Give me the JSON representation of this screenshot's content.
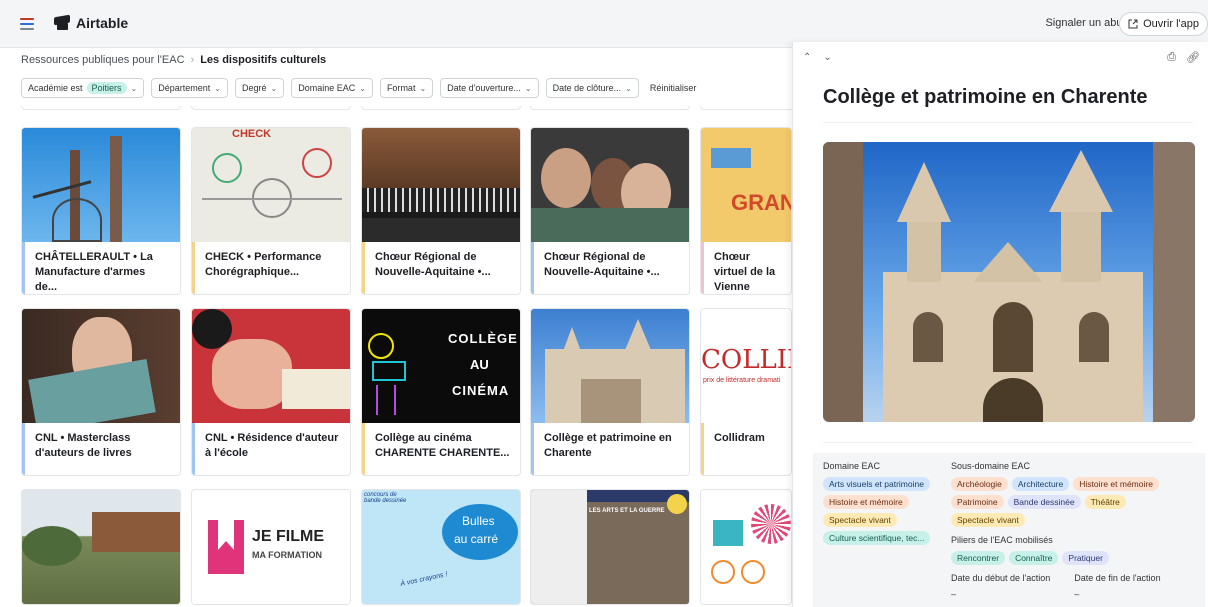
{
  "app": {
    "brand": "Airtable",
    "report_label": "Signaler un abus",
    "open_app_label": "Ouvrir l'app"
  },
  "breadcrumb": {
    "parent": "Ressources publiques pour l'EAC",
    "current": "Les dispositifs culturels"
  },
  "filters": [
    {
      "label": "Académie est",
      "chip": "Poitiers"
    },
    {
      "label": "Département"
    },
    {
      "label": "Degré"
    },
    {
      "label": "Domaine EAC"
    },
    {
      "label": "Format"
    },
    {
      "label": "Date d'ouverture..."
    },
    {
      "label": "Date de clôture..."
    }
  ],
  "reset_label": "Réinitialiser",
  "cards": [
    {
      "title": "CHÂTELLERAULT • La Manufacture d'armes de...",
      "accent": "#9fc6f0"
    },
    {
      "title": "CHECK • Performance Chorégraphique...",
      "accent": "#f5d48a"
    },
    {
      "title": "Chœur Régional de Nouvelle-Aquitaine •...",
      "accent": "#f5d48a"
    },
    {
      "title": "Chœur Régional de Nouvelle-Aquitaine •...",
      "accent": "#9fc6f0"
    },
    {
      "title": "Chœur virtuel de la Vienne",
      "accent": "#f3c0d4"
    },
    {
      "title": "CNL • Masterclass d'auteurs de livres",
      "accent": "#9fc6f0"
    },
    {
      "title": "CNL • Résidence d'auteur à l'école",
      "accent": "#9fc6f0"
    },
    {
      "title": "Collège au cinéma CHARENTE CHARENTE...",
      "accent": "#f5d48a"
    },
    {
      "title": "Collège et patrimoine en Charente",
      "accent": "#9fc6f0"
    },
    {
      "title": "Collidram",
      "accent": "#f5d48a"
    }
  ],
  "card_images": {
    "cinema_line1": "COLLÈGE",
    "cinema_line2": "AU",
    "cinema_line3": "CINÉMA",
    "collidram_text": "COLLID",
    "collidram_sub": "prix de littérature dramati",
    "jefilme_line1": "JE FILME",
    "jefilme_line2": "MA FORMATION",
    "bulles_line1": "Bulles",
    "bulles_line2": "au carré",
    "bulles_top": "concours de bande dessinée",
    "bulles_bottom": "À vos crayons !",
    "check_text": "CHECK",
    "arts_guerre": "LES ARTS ET LA GUERRE",
    "grand_text": "GRAN"
  },
  "panel": {
    "title": "Collège et patrimoine en Charente",
    "domaine_label": "Domaine EAC",
    "domaine_tags": [
      {
        "text": "Arts visuels et patrimoine",
        "color": "blue"
      },
      {
        "text": "Histoire et mémoire",
        "color": "orange"
      },
      {
        "text": "Spectacle vivant",
        "color": "yellow"
      },
      {
        "text": "Culture scientifique, tec...",
        "color": "teal"
      }
    ],
    "sous_label": "Sous-domaine EAC",
    "sous_tags": [
      {
        "text": "Archéologie",
        "color": "orange"
      },
      {
        "text": "Architecture",
        "color": "blue"
      },
      {
        "text": "Histoire et mémoire",
        "color": "orange"
      },
      {
        "text": "Patrimoine",
        "color": "orange"
      },
      {
        "text": "Bande dessinée",
        "color": "lav"
      },
      {
        "text": "Théâtre",
        "color": "yellow"
      },
      {
        "text": "Spectacle vivant",
        "color": "yellow"
      }
    ],
    "piliers_label": "Piliers de l'EAC mobilisés",
    "piliers_tags": [
      {
        "text": "Rencontrer",
        "color": "teal"
      },
      {
        "text": "Connaître",
        "color": "teal"
      },
      {
        "text": "Pratiquer",
        "color": "lav"
      }
    ],
    "date_start_label": "Date du début de l'action",
    "date_end_label": "Date de fin de l'action",
    "date_start_value": "–",
    "date_end_value": "–"
  }
}
